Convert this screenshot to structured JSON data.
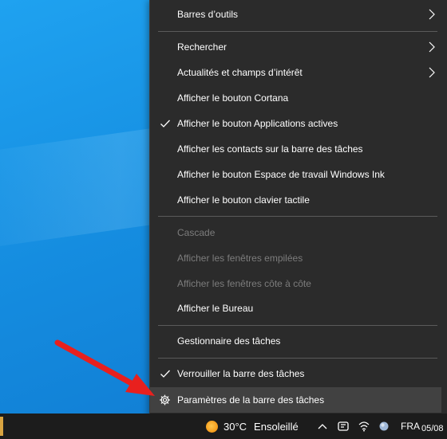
{
  "menu": {
    "items": [
      {
        "label": "Barres d’outils",
        "submenu": true
      },
      {
        "label": "Rechercher",
        "submenu": true
      },
      {
        "label": "Actualités et champs d’intérêt",
        "submenu": true
      },
      {
        "label": "Afficher le bouton Cortana"
      },
      {
        "label": "Afficher le bouton Applications actives",
        "checked": true
      },
      {
        "label": "Afficher les contacts sur la barre des tâches"
      },
      {
        "label": "Afficher le bouton Espace de travail Windows Ink"
      },
      {
        "label": "Afficher le bouton clavier tactile"
      },
      {
        "label": "Cascade",
        "disabled": true
      },
      {
        "label": "Afficher les fenêtres empilées",
        "disabled": true
      },
      {
        "label": "Afficher les fenêtres côte à côte",
        "disabled": true
      },
      {
        "label": "Afficher le Bureau"
      },
      {
        "label": "Gestionnaire des tâches"
      },
      {
        "label": "Verrouiller la barre des tâches",
        "checked": true
      },
      {
        "label": "Paramètres de la barre des tâches",
        "icon": "gear-icon",
        "highlighted": true
      }
    ]
  },
  "taskbar": {
    "weather": {
      "temperature": "30°C",
      "condition": "Ensoleillé",
      "icon": "sun-icon"
    },
    "tray": {
      "chevron_icon": "chevron-up-icon",
      "network_icon": "wifi-icon",
      "app_icon": "app-tray-icon",
      "language": "FRA"
    },
    "clock": {
      "date": "05/08"
    }
  },
  "colors": {
    "menu_bg": "#2b2b2b",
    "menu_hover": "#414141",
    "disabled_text": "#7c7c7c",
    "desktop": "#1a8fe0",
    "taskbar": "#1c1c1c",
    "annotation_arrow": "#e8201e"
  }
}
